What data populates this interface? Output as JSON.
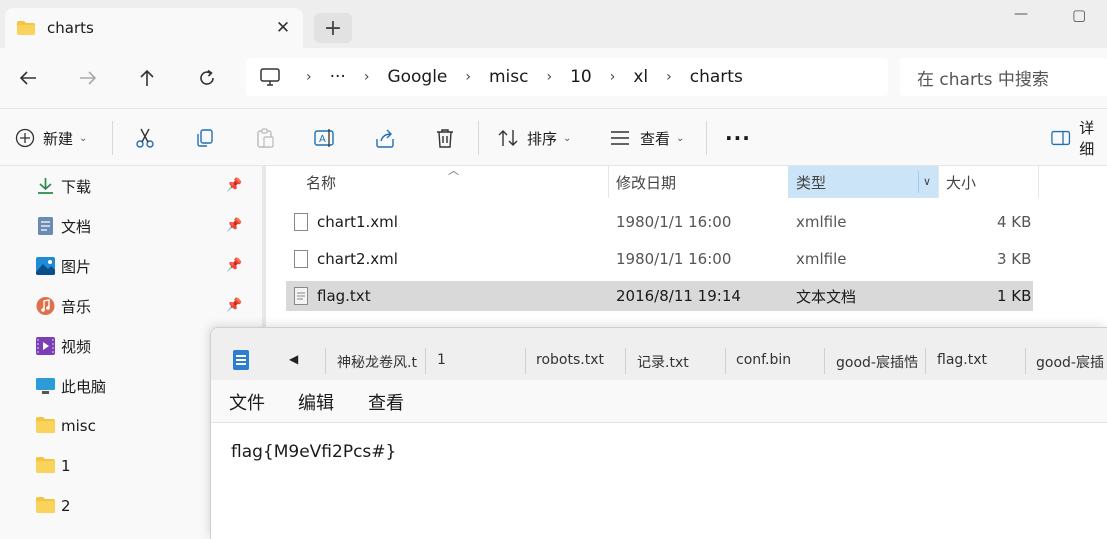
{
  "window": {
    "tab_label": "charts",
    "newtab_label": "+",
    "close_glyph": "✕",
    "minimize_glyph": "—",
    "maximize_glyph": "▢"
  },
  "address": {
    "crumbs": [
      "···",
      "Google",
      "misc",
      "10",
      "xl",
      "charts"
    ],
    "separator": "›",
    "search_placeholder": "在 charts 中搜索"
  },
  "toolbar": {
    "new_label": "新建",
    "sort_label": "排序",
    "view_label": "查看",
    "more_glyph": "···",
    "details_label": "详细"
  },
  "sidebar": {
    "items": [
      {
        "label": "下载",
        "icon": "download-icon",
        "pinned": true
      },
      {
        "label": "文档",
        "icon": "document-icon",
        "pinned": true
      },
      {
        "label": "图片",
        "icon": "picture-icon",
        "pinned": true
      },
      {
        "label": "音乐",
        "icon": "music-icon",
        "pinned": true
      },
      {
        "label": "视频",
        "icon": "video-icon",
        "pinned": false
      },
      {
        "label": "此电脑",
        "icon": "computer-icon",
        "pinned": false
      },
      {
        "label": "misc",
        "icon": "folder-icon",
        "pinned": false
      },
      {
        "label": "1",
        "icon": "folder-icon",
        "pinned": false
      },
      {
        "label": "2",
        "icon": "folder-icon",
        "pinned": false
      }
    ]
  },
  "filelist": {
    "columns": {
      "name": "名称",
      "modified": "修改日期",
      "type": "类型",
      "size": "大小"
    },
    "rows": [
      {
        "name": "chart1.xml",
        "modified": "1980/1/1 16:00",
        "type": "xmlfile",
        "size": "4 KB",
        "selected": false
      },
      {
        "name": "chart2.xml",
        "modified": "1980/1/1 16:00",
        "type": "xmlfile",
        "size": "3 KB",
        "selected": false
      },
      {
        "name": "flag.txt",
        "modified": "2016/8/11 19:14",
        "type": "文本文档",
        "size": "1 KB",
        "selected": true
      }
    ]
  },
  "notepad": {
    "tabs": [
      "神秘龙卷风.t",
      "1",
      "robots.txt",
      "记录.txt",
      "conf.bin",
      "good-宸插悎",
      "flag.txt",
      "good-宸插"
    ],
    "menu": {
      "file": "文件",
      "edit": "编辑",
      "view": "查看"
    },
    "content": "flag{M9eVfi2Pcs#}"
  },
  "colors": {
    "accent": "#0067c0",
    "folder": "#f6c342",
    "sorted_header": "#cce4f7",
    "selection": "#d9d9d9"
  }
}
